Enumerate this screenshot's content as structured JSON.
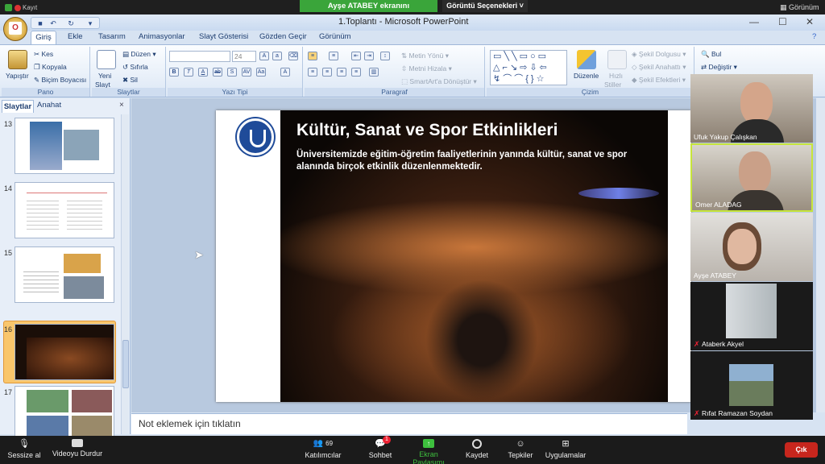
{
  "zoom": {
    "share_banner": "Ayşe ATABEY ekranını görüntülüyorsunuz",
    "view_options": "Görüntü Seçenekleri",
    "record": "Kayıt",
    "view": "Görünüm",
    "participants_count": "69",
    "chat_badge": "1",
    "toolbar": {
      "mute": "Sessize al",
      "stop_video": "Videoyu Durdur",
      "participants": "Katılımcılar",
      "chat": "Sohbet",
      "share": "Ekran Paylaşımı",
      "record": "Kaydet",
      "reactions": "Tepkiler",
      "apps": "Uygulamalar",
      "leave": "Çık"
    },
    "participants": [
      {
        "name": "Ufuk Yakup Çalışkan",
        "muted": false
      },
      {
        "name": "Omer ALADAG",
        "muted": false
      },
      {
        "name": "Ayşe ATABEY",
        "muted": false
      },
      {
        "name": "Ataberk Akyel",
        "muted": true
      },
      {
        "name": "Rıfat Ramazan Soydan",
        "muted": true
      }
    ]
  },
  "ppt": {
    "title": "1.Toplantı - Microsoft PowerPoint",
    "tabs": [
      "Giriş",
      "Ekle",
      "Tasarım",
      "Animasyonlar",
      "Slayt Gösterisi",
      "Gözden Geçir",
      "Görünüm"
    ],
    "ribbon": {
      "pano": {
        "label": "Pano",
        "paste": "Yapıştır",
        "cut": "Kes",
        "copy": "Kopyala",
        "format_painter": "Biçim Boyacısı"
      },
      "slaytlar": {
        "label": "Slaytlar",
        "new_slide": "Yeni",
        "new_slide2": "Slayt",
        "layout": "Düzen",
        "reset": "Sıfırla",
        "delete": "Sil"
      },
      "yazi_tipi": {
        "label": "Yazı Tipi",
        "size": "24"
      },
      "paragraf": {
        "label": "Paragraf",
        "text_direction": "Metin Yönü",
        "align_text": "Metni Hizala",
        "smartart": "SmartArt'a Dönüştür"
      },
      "cizim": {
        "label": "Çizim",
        "arrange": "Düzenle",
        "quick_styles": "Hızlı",
        "quick_styles2": "Stiller",
        "shape_fill": "Şekil Dolgusu",
        "shape_outline": "Şekil Anahattı",
        "shape_effects": "Şekil Efektleri"
      },
      "duzenleme": {
        "find": "Bul",
        "replace": "Değiştir"
      }
    },
    "panel": {
      "tab_slides": "Slaytlar",
      "tab_outline": "Anahat",
      "close": "×"
    },
    "thumbnails": [
      "13",
      "14",
      "15",
      "16",
      "17"
    ],
    "slide": {
      "title": "Kültür, Sanat ve Spor Etkinlikleri",
      "body": "Üniversitemizde eğitim-öğretim faaliyetlerinin yanında kültür, sanat ve spor alanında birçok etkinlik düzenlenmektedir."
    },
    "notes_placeholder": "Not eklemek için tıklatın"
  }
}
